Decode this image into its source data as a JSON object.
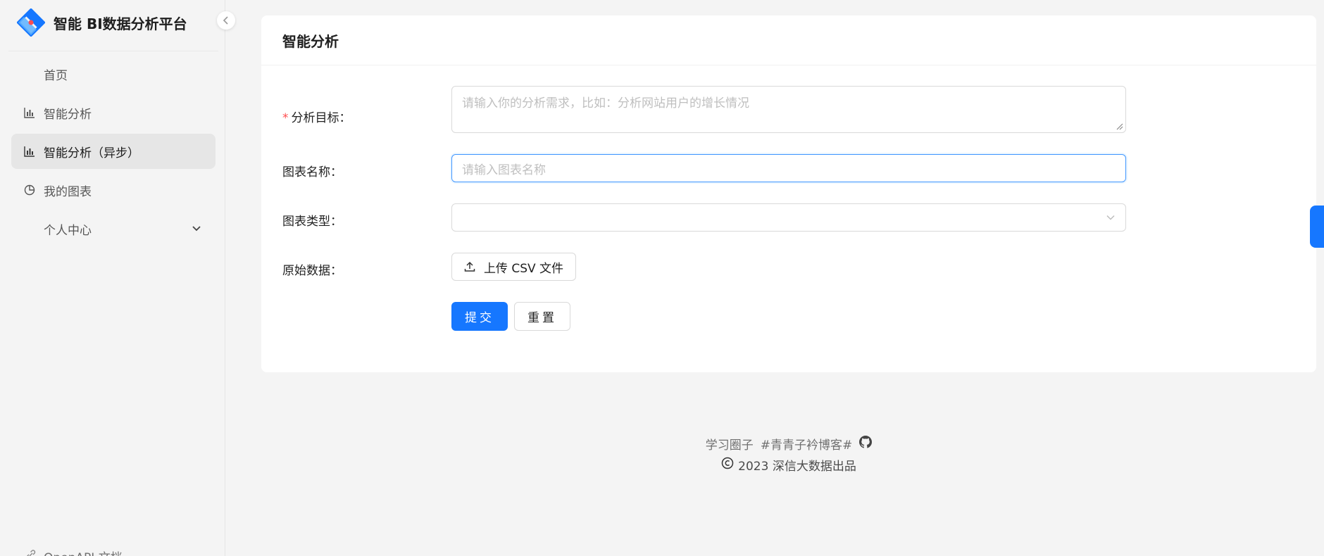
{
  "app": {
    "title": "智能 BI数据分析平台"
  },
  "sidebar": {
    "items": [
      {
        "label": "首页",
        "icon": ""
      },
      {
        "label": "智能分析",
        "icon": "bar-chart-icon"
      },
      {
        "label": "智能分析（异步）",
        "icon": "bar-chart-icon",
        "active": true
      },
      {
        "label": "我的图表",
        "icon": "pie-chart-icon"
      },
      {
        "label": "个人中心",
        "icon": "",
        "expandable": true
      }
    ],
    "bottom_link": "OpenAPI 文档"
  },
  "card": {
    "title": "智能分析",
    "goal": {
      "label": "分析目标：",
      "placeholder": "请输入你的分析需求，比如：分析网站用户的增长情况",
      "required": true
    },
    "chart_name": {
      "label": "图表名称：",
      "placeholder": "请输入图表名称"
    },
    "chart_type": {
      "label": "图表类型：",
      "value": ""
    },
    "raw_data": {
      "label": "原始数据：",
      "upload_label": "上传 CSV 文件"
    },
    "buttons": {
      "submit": "提交",
      "reset": "重置"
    }
  },
  "footer": {
    "link1": "学习圈子",
    "link2": "#青青子衿博客#",
    "copyright": "2023 深信大数据出品"
  },
  "colors": {
    "primary": "#1677ff",
    "required": "#ff4d4f",
    "background": "#f4f4f4"
  }
}
